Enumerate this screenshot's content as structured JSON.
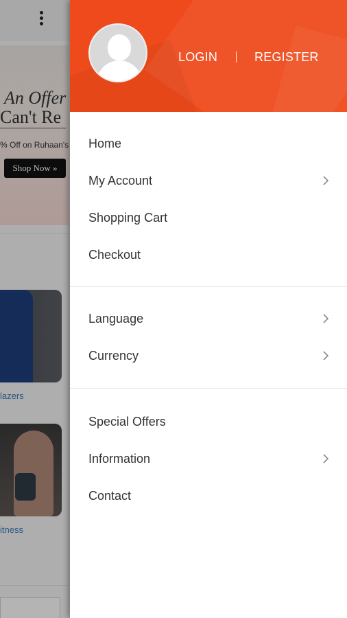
{
  "background_app": {
    "banner_line1": "An Offer",
    "banner_line2": "Can't Re",
    "banner_sub": "% Off on Ruhaan's",
    "shop_label": "Shop Now »",
    "card1_caption": "lazers",
    "card2_caption": "itness"
  },
  "drawer": {
    "header": {
      "login_label": "LOGIN",
      "register_label": "REGISTER",
      "accent_color": "#EF4A1B"
    },
    "sections": [
      {
        "items": [
          {
            "label": "Home",
            "has_submenu": false
          },
          {
            "label": "My Account",
            "has_submenu": true
          },
          {
            "label": "Shopping Cart",
            "has_submenu": false
          },
          {
            "label": "Checkout",
            "has_submenu": false
          }
        ]
      },
      {
        "items": [
          {
            "label": "Language",
            "has_submenu": true
          },
          {
            "label": "Currency",
            "has_submenu": true
          }
        ]
      },
      {
        "items": [
          {
            "label": "Special Offers",
            "has_submenu": false
          },
          {
            "label": "Information",
            "has_submenu": true
          },
          {
            "label": "Contact",
            "has_submenu": false
          }
        ]
      }
    ]
  },
  "icons": {
    "avatar": "user-silhouette-icon",
    "submenu": "chevron-right-icon",
    "overflow": "more-vertical-icon"
  }
}
